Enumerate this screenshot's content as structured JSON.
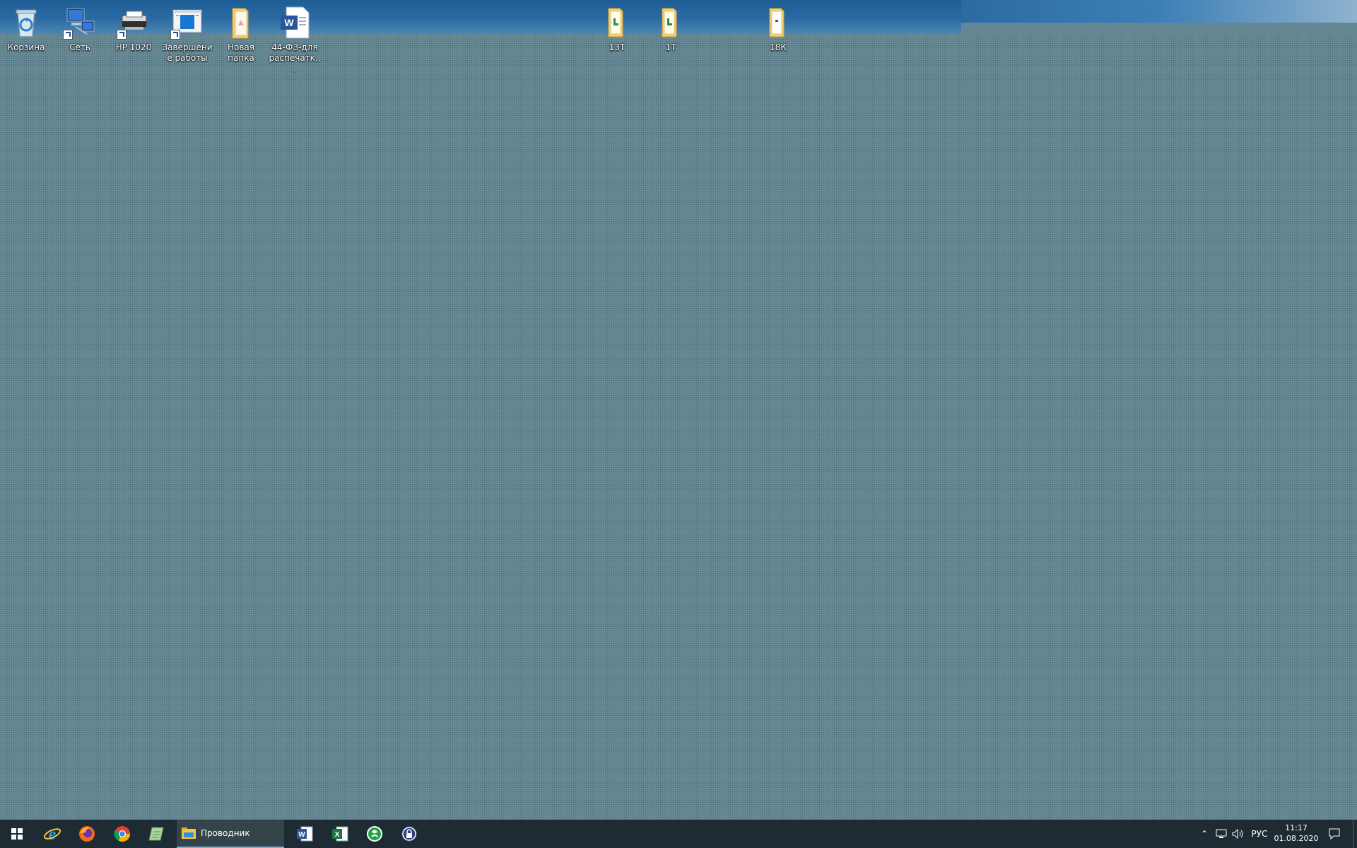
{
  "desktop": {
    "icons": [
      {
        "label": "Корзина",
        "icon": "recycle-bin-icon"
      },
      {
        "label": "Сеть",
        "icon": "network-icon"
      },
      {
        "label": "HP 1020",
        "icon": "printer-icon"
      },
      {
        "label": "Завершение работы",
        "icon": "shutdown-shortcut-icon"
      },
      {
        "label": "Новая папка",
        "icon": "folder-icon"
      },
      {
        "label": "44-ФЗ-для распечатк...",
        "icon": "word-document-icon"
      },
      {
        "label": "13Т",
        "icon": "folder-icon"
      },
      {
        "label": "1Т",
        "icon": "folder-icon"
      },
      {
        "label": "18К",
        "icon": "folder-icon"
      }
    ]
  },
  "taskbar": {
    "explorer_label": "Проводник",
    "apps": [
      "start-icon",
      "internet-explorer-icon",
      "firefox-icon",
      "chrome-icon",
      "notepad-icon",
      "explorer-icon",
      "word-icon",
      "excel-icon",
      "green-app-icon",
      "lock-app-icon"
    ],
    "language": "РУС",
    "time": "11:17",
    "date": "01.08.2020"
  },
  "colors": {
    "desktop_bg": "#648793",
    "taskbar_bg": "#1f2b33",
    "folder_yellow": "#f3d16b",
    "word_blue": "#2b579a",
    "excel_green": "#217346"
  }
}
